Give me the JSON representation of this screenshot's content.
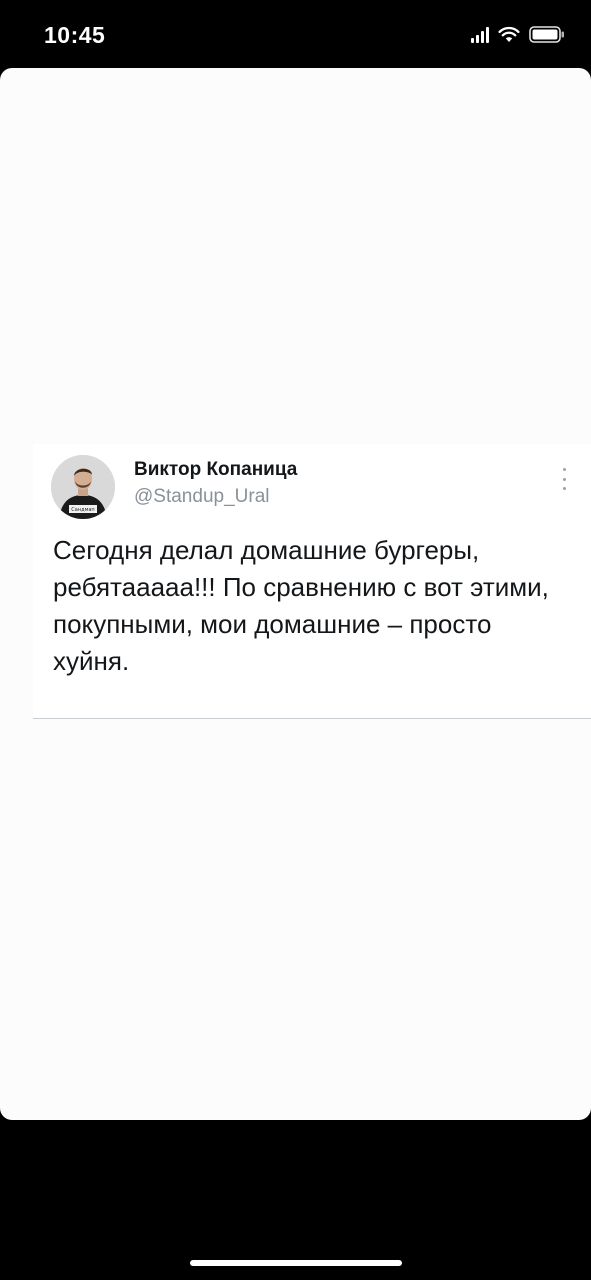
{
  "status_bar": {
    "time": "10:45",
    "icons": [
      "signal-icon",
      "wifi-icon",
      "battery-icon"
    ]
  },
  "tweet": {
    "author_name": "Виктор Копаница",
    "author_handle": "@Standup_Ural",
    "text": "Сегодня делал домашние бургеры, ребятааааа!!! По сравнению с вот этими, покупными, мои домашние – просто хуйня.",
    "avatar_shirt_text": "Сандмап",
    "menu_icon": "more-vertical-icon"
  },
  "colors": {
    "background": "#000000",
    "card": "#fcfcfc",
    "tweet_text": "#14171a",
    "handle": "#8a9199",
    "divider": "#c9ced3"
  }
}
